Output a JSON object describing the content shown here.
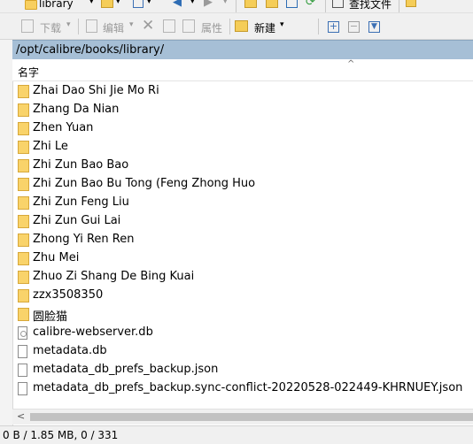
{
  "toolbar_top": {
    "location_label": "library",
    "find_files_label": "查找文件"
  },
  "toolbar_main": {
    "download_label": "下载",
    "edit_label": "编辑",
    "properties_label": "属性",
    "new_label": "新建"
  },
  "path": "/opt/calibre/books/library/",
  "list_header": {
    "name_label": "名字",
    "sort_indicator": "^"
  },
  "items": [
    {
      "name": "Zhai Dao Shi Jie Mo Ri",
      "type": "folder"
    },
    {
      "name": "Zhang Da Nian",
      "type": "folder"
    },
    {
      "name": "Zhen Yuan",
      "type": "folder"
    },
    {
      "name": "Zhi Le",
      "type": "folder"
    },
    {
      "name": "Zhi Zun Bao Bao",
      "type": "folder"
    },
    {
      "name": "Zhi Zun Bao Bu Tong (Feng Zhong Huo",
      "type": "folder"
    },
    {
      "name": "Zhi Zun Feng Liu",
      "type": "folder"
    },
    {
      "name": "Zhi Zun Gui Lai",
      "type": "folder"
    },
    {
      "name": "Zhong Yi Ren Ren",
      "type": "folder"
    },
    {
      "name": "Zhu Mei",
      "type": "folder"
    },
    {
      "name": "Zhuo Zi Shang De Bing Kuai",
      "type": "folder"
    },
    {
      "name": "zzx3508350",
      "type": "folder"
    },
    {
      "name": "圆脸猫",
      "type": "folder"
    },
    {
      "name": "calibre-webserver.db",
      "type": "db-file"
    },
    {
      "name": "metadata.db",
      "type": "db-file"
    },
    {
      "name": "metadata_db_prefs_backup.json",
      "type": "file"
    },
    {
      "name": "metadata_db_prefs_backup.sync-conflict-20220528-022449-KHRNUEY.json",
      "type": "file"
    }
  ],
  "scrollbar": {
    "left_arrow": "<"
  },
  "status_bar": {
    "text": "0 B / 1.85 MB,   0 / 331"
  },
  "colors": {
    "path_bar_bg": "#a6bfd6",
    "folder": "#f9d36a",
    "toolbar_bg": "#f0f0f0"
  }
}
